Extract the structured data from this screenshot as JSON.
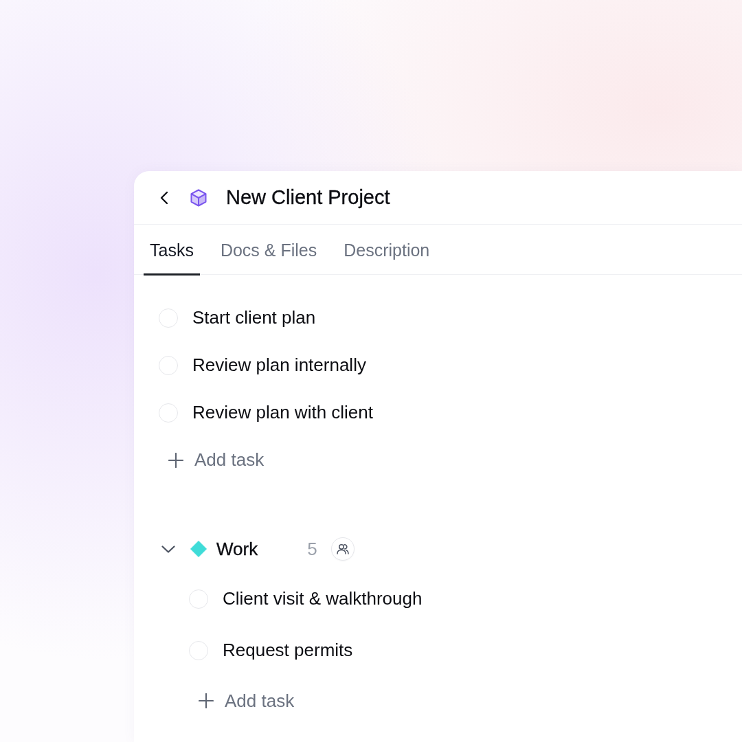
{
  "header": {
    "title": "New Client Project"
  },
  "tabs": [
    {
      "label": "Tasks",
      "selected": true
    },
    {
      "label": "Docs & Files",
      "selected": false
    },
    {
      "label": "Description",
      "selected": false
    }
  ],
  "tasks": [
    {
      "title": "Start client plan",
      "checked": false
    },
    {
      "title": "Review plan internally",
      "checked": false
    },
    {
      "title": "Review plan with client",
      "checked": false
    }
  ],
  "add_task": "Add task",
  "groups": [
    {
      "name": "Work",
      "color": "#3fdcd8",
      "count": "5",
      "expanded": true,
      "tasks": [
        {
          "title": "Client visit & walkthrough",
          "checked": false
        },
        {
          "title": "Request permits",
          "checked": false
        }
      ],
      "add_task": "Add task"
    }
  ]
}
